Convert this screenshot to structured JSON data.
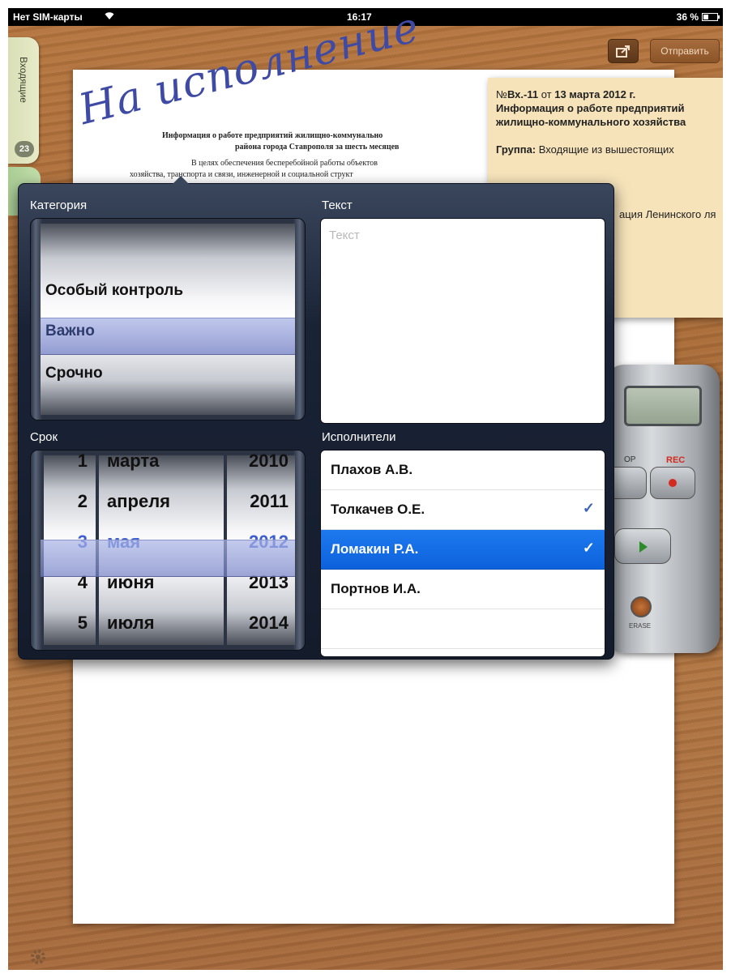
{
  "status_bar": {
    "carrier": "Нет SIM-карты",
    "wifi_icon": "wifi-icon",
    "time": "16:17",
    "battery": "36 %"
  },
  "toolbar": {
    "share_icon": "share-icon",
    "send_label": "Отправить"
  },
  "sidebar": {
    "inbox_label": "Входящие",
    "inbox_count": "23"
  },
  "document": {
    "stamp": "На исполнение",
    "lines": [
      "Информация о работе предприятий жилищно-коммунально",
      "района города Ставрополя за шесть месяцев",
      "В целях обеспечения бесперебойной работы объектов",
      "хозяйства, транспорта и связи, инженерной и социальной структ"
    ]
  },
  "note": {
    "number_prefix": "№",
    "number": "Вх.-11",
    "from": " от ",
    "date": "13 марта 2012 г.",
    "title": "Информация о работе предприятий жилищно-коммунального хозяйства",
    "group_label": "Группа:",
    "group_value": " Входящие из вышестоящих",
    "extra": "ация Ленинского ля"
  },
  "popover": {
    "category_label": "Категория",
    "category_options": [
      "Особый контроль",
      "Важно",
      "Срочно"
    ],
    "category_selected": "Важно",
    "text_label": "Текст",
    "text_placeholder": "Текст",
    "deadline_label": "Срок",
    "days": [
      "1",
      "2",
      "3",
      "4",
      "5"
    ],
    "months": [
      "марта",
      "апреля",
      "мая",
      "июня",
      "июля"
    ],
    "years": [
      "2010",
      "2011",
      "2012",
      "2013",
      "2014"
    ],
    "selected_day": "3",
    "selected_month": "мая",
    "selected_year": "2012",
    "assignees_label": "Исполнители",
    "assignees": [
      {
        "name": "Плахов А.В.",
        "check": ""
      },
      {
        "name": "Толкачев О.Е.",
        "check": "✓"
      },
      {
        "name": "Ломакин Р.А.",
        "check": "✓"
      },
      {
        "name": "Портнов И.А.",
        "check": ""
      }
    ]
  },
  "recorder": {
    "rec_label": "REC",
    "stop_label": "OP",
    "erase_label": "ERASE"
  },
  "footer": {
    "settings_icon": "gear-icon"
  }
}
